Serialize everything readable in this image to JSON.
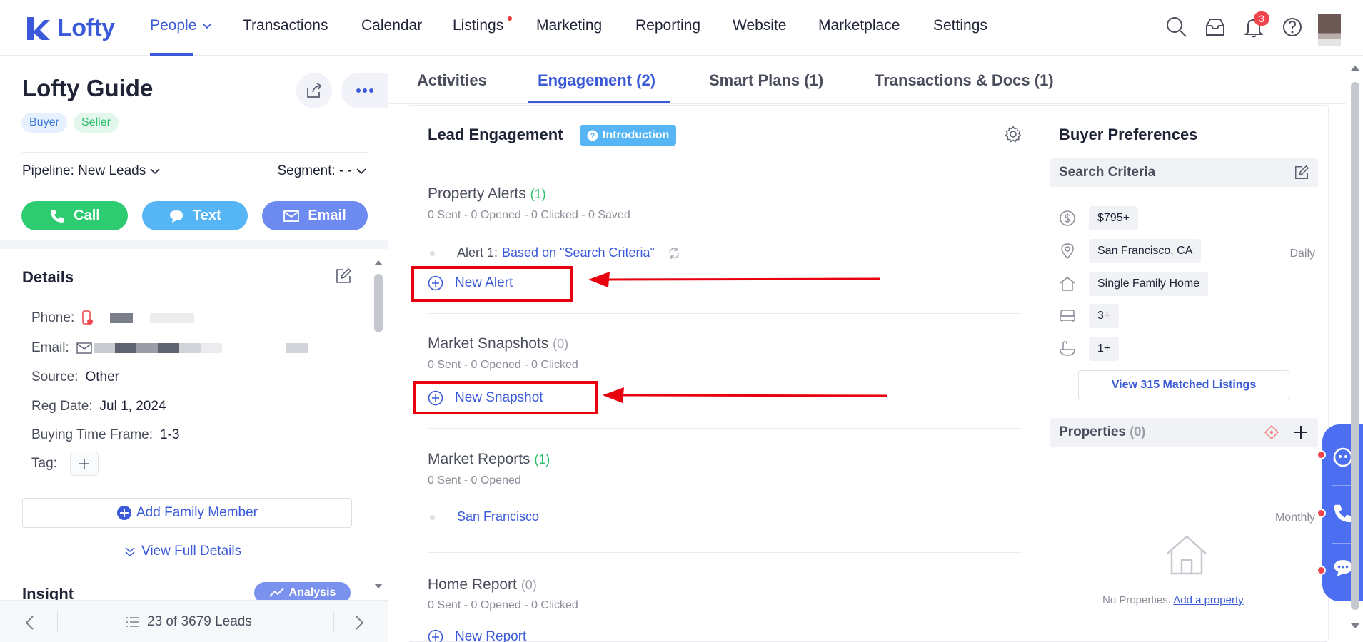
{
  "nav": {
    "logo_text": "Lofty",
    "items": [
      "People",
      "Transactions",
      "Calendar",
      "Listings",
      "Marketing",
      "Reporting",
      "Website",
      "Marketplace",
      "Settings"
    ],
    "notification_count": "3"
  },
  "lead": {
    "name": "Lofty Guide",
    "tags": [
      "Buyer",
      "Seller"
    ],
    "pipeline": "Pipeline: New Leads",
    "segment": "Segment: - -",
    "actions": {
      "call": "Call",
      "text": "Text",
      "email": "Email"
    }
  },
  "details": {
    "title": "Details",
    "phone_label": "Phone:",
    "email_label": "Email:",
    "source_label": "Source:",
    "source": "Other",
    "reg_date_label": "Reg Date:",
    "reg_date": "Jul 1, 2024",
    "time_frame_label": "Buying Time Frame:",
    "time_frame": "1-3",
    "tag_label": "Tag:",
    "add_family": "Add Family Member",
    "view_full": "View Full Details"
  },
  "insight": {
    "title": "Insight",
    "analysis_label": "Analysis"
  },
  "pager": {
    "text": "23 of 3679 Leads"
  },
  "tabs": [
    "Activities",
    "Engagement (2)",
    "Smart Plans (1)",
    "Transactions & Docs (1)"
  ],
  "engagement": {
    "title": "Lead Engagement",
    "intro_badge": "Introduction",
    "property_alerts": {
      "title": "Property Alerts",
      "count": "(1)",
      "stats": "0 Sent - 0 Opened - 0 Clicked - 0 Saved",
      "alert_prefix": "Alert 1:",
      "alert_link": "Based on \"Search Criteria\"",
      "frequency": "Daily",
      "new_label": "New Alert"
    },
    "market_snapshots": {
      "title": "Market Snapshots",
      "count": "(0)",
      "stats": "0 Sent - 0 Opened - 0 Clicked",
      "new_label": "New Snapshot"
    },
    "market_reports": {
      "title": "Market Reports",
      "count": "(1)",
      "stats": "0 Sent - 0 Opened",
      "item": "San Francisco",
      "frequency": "Monthly"
    },
    "home_report": {
      "title": "Home Report",
      "count": "(0)",
      "stats": "0 Sent - 0 Opened - 0 Clicked",
      "new_label": "New Report"
    }
  },
  "buyer_preferences": {
    "title": "Buyer Preferences",
    "search_criteria_label": "Search Criteria",
    "criteria": [
      "$795+",
      "San Francisco, CA",
      "Single Family Home",
      "3+",
      "1+"
    ],
    "matched_label": "View 315 Matched Listings",
    "properties_label": "Properties",
    "properties_count": "(0)",
    "no_props_text": "No Properties.",
    "add_property": "Add a property"
  },
  "colors": {
    "accent": "#3a5ad9",
    "green": "#2dcc70",
    "annotation_red": "#e8000f"
  }
}
